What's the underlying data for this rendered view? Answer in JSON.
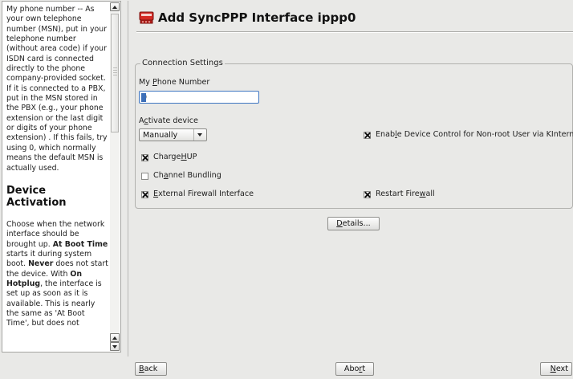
{
  "help": {
    "paragraph1": "My phone number -- As your own telephone number (MSN), put in your telephone number (without area code) if your ISDN card is connected directly to the phone company-provided socket. If it is connected to a PBX, put in the MSN stored in the PBX (e.g., your phone extension or the last digit or digits of your phone extension) . If this fails, try using 0, which normally means the default MSN is actually used.",
    "heading": "Device Activation",
    "p2_a": "Choose when the network interface should be brought up. ",
    "p2_b1": "At Boot Time",
    "p2_c": " starts it during system boot. ",
    "p2_b2": "Never",
    "p2_d": " does not start the device. With ",
    "p2_b3": "On Hotplug",
    "p2_e": ", the interface is set up as soon as it is available. This is nearly the same as 'At Boot Time', but does not"
  },
  "dialog": {
    "title": "Add SyncPPP Interface ippp0",
    "group_legend": "Connection Settings",
    "phone_label_pre": "My ",
    "phone_label_acc": "P",
    "phone_label_post": "hone Number",
    "phone_value": "0",
    "activate_label_pre": "A",
    "activate_label_acc": "c",
    "activate_label_post": "tivate device",
    "activate_value": "Manually",
    "chargehup_pre": "Charge",
    "chargehup_acc": "H",
    "chargehup_post": "UP",
    "chargehup_checked": true,
    "channel_pre": "Ch",
    "channel_acc": "a",
    "channel_post": "nnel Bundling",
    "channel_checked": false,
    "extfw_pre": "",
    "extfw_acc": "E",
    "extfw_post": "xternal Firewall Interface",
    "extfw_checked": true,
    "devctl_pre": "Enab",
    "devctl_acc": "l",
    "devctl_post": "e Device Control for Non-root User via KInternet",
    "devctl_checked": true,
    "restartfw_pre": "Restart Fire",
    "restartfw_acc": "w",
    "restartfw_post": "all",
    "restartfw_checked": true,
    "details_acc": "D",
    "details_post": "etails..."
  },
  "footer": {
    "back_acc": "B",
    "back_post": "ack",
    "abort_pre": "Abo",
    "abort_acc": "r",
    "abort_post": "t",
    "next_acc": "N",
    "next_post": "ext"
  },
  "colors": {
    "title_icon": "#d42a24",
    "input_focus": "#3f76c2"
  },
  "icons": {
    "title_icon": "network-device-icon"
  }
}
